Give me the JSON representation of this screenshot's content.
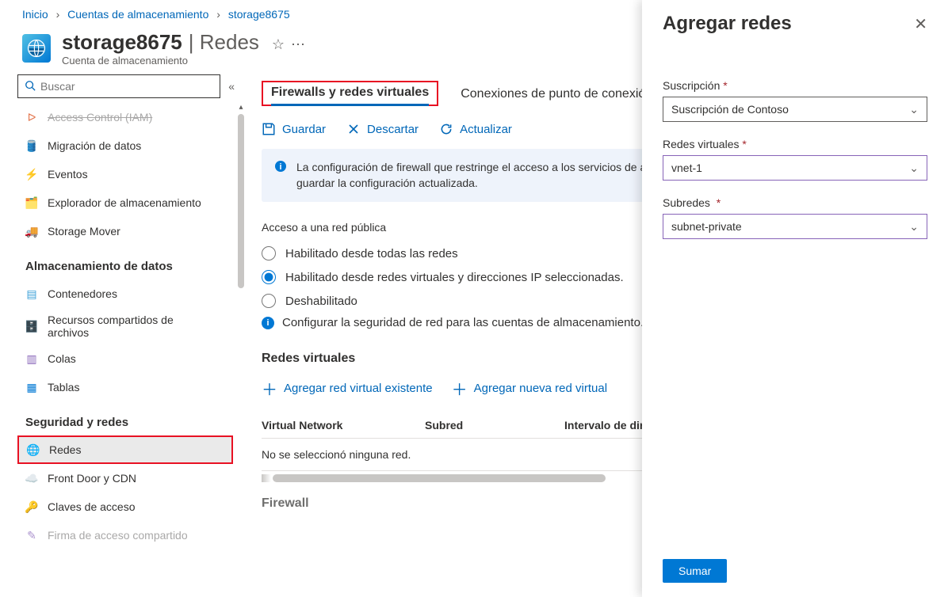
{
  "breadcrumb": {
    "home": "Inicio",
    "accounts": "Cuentas de almacenamiento",
    "name": "storage8675"
  },
  "header": {
    "name": "storage8675",
    "section": "Redes",
    "category": "Cuenta de almacenamiento"
  },
  "search": {
    "placeholder": "Buscar"
  },
  "nav": {
    "access": "Access Control (IAM)",
    "migration": "Migración de datos",
    "events": "Eventos",
    "explorer": "Explorador de almacenamiento",
    "mover": "Storage Mover",
    "group_storage": "Almacenamiento de datos",
    "containers": "Contenedores",
    "fileshares": "Recursos compartidos de archivos",
    "queues": "Colas",
    "tables": "Tablas",
    "group_security": "Seguridad y redes",
    "networks": "Redes",
    "frontdoor": "Front Door y CDN",
    "keys": "Claves de acceso",
    "sas": "Firma de acceso compartido"
  },
  "tabs": {
    "firewalls": "Firewalls y redes virtuales",
    "endpoints": "Conexiones de punto de conexión privado"
  },
  "toolbar": {
    "save": "Guardar",
    "discard": "Descartar",
    "refresh": "Actualizar"
  },
  "banner": "La configuración de firewall que restringe el acceso a los servicios de almacenamiento tardará hasta un minuto después de guardar la configuración actualizada.",
  "publicAccess": {
    "label": "Acceso a una red pública",
    "opt_all": "Habilitado desde todas las redes",
    "opt_selected": "Habilitado desde redes virtuales y direcciones IP seleccionadas.",
    "opt_disabled": "Deshabilitado",
    "info": "Configurar la seguridad de red para las cuentas de almacenamiento."
  },
  "vnet": {
    "heading": "Redes virtuales",
    "add_existing": "Agregar red virtual existente",
    "add_new": "Agregar nueva red virtual",
    "col_vnet": "Virtual Network",
    "col_subnet": "Subred",
    "col_range": "Intervalo de direcciones",
    "empty": "No se seleccionó ninguna red."
  },
  "firewall_heading": "Firewall",
  "panel": {
    "title": "Agregar redes",
    "sub_label": "Suscripción",
    "sub_value": "Suscripción de Contoso",
    "vnet_label": "Redes virtuales",
    "vnet_value": "vnet-1",
    "subnet_label": "Subredes",
    "subnet_value": "subnet-private",
    "submit": "Sumar"
  }
}
